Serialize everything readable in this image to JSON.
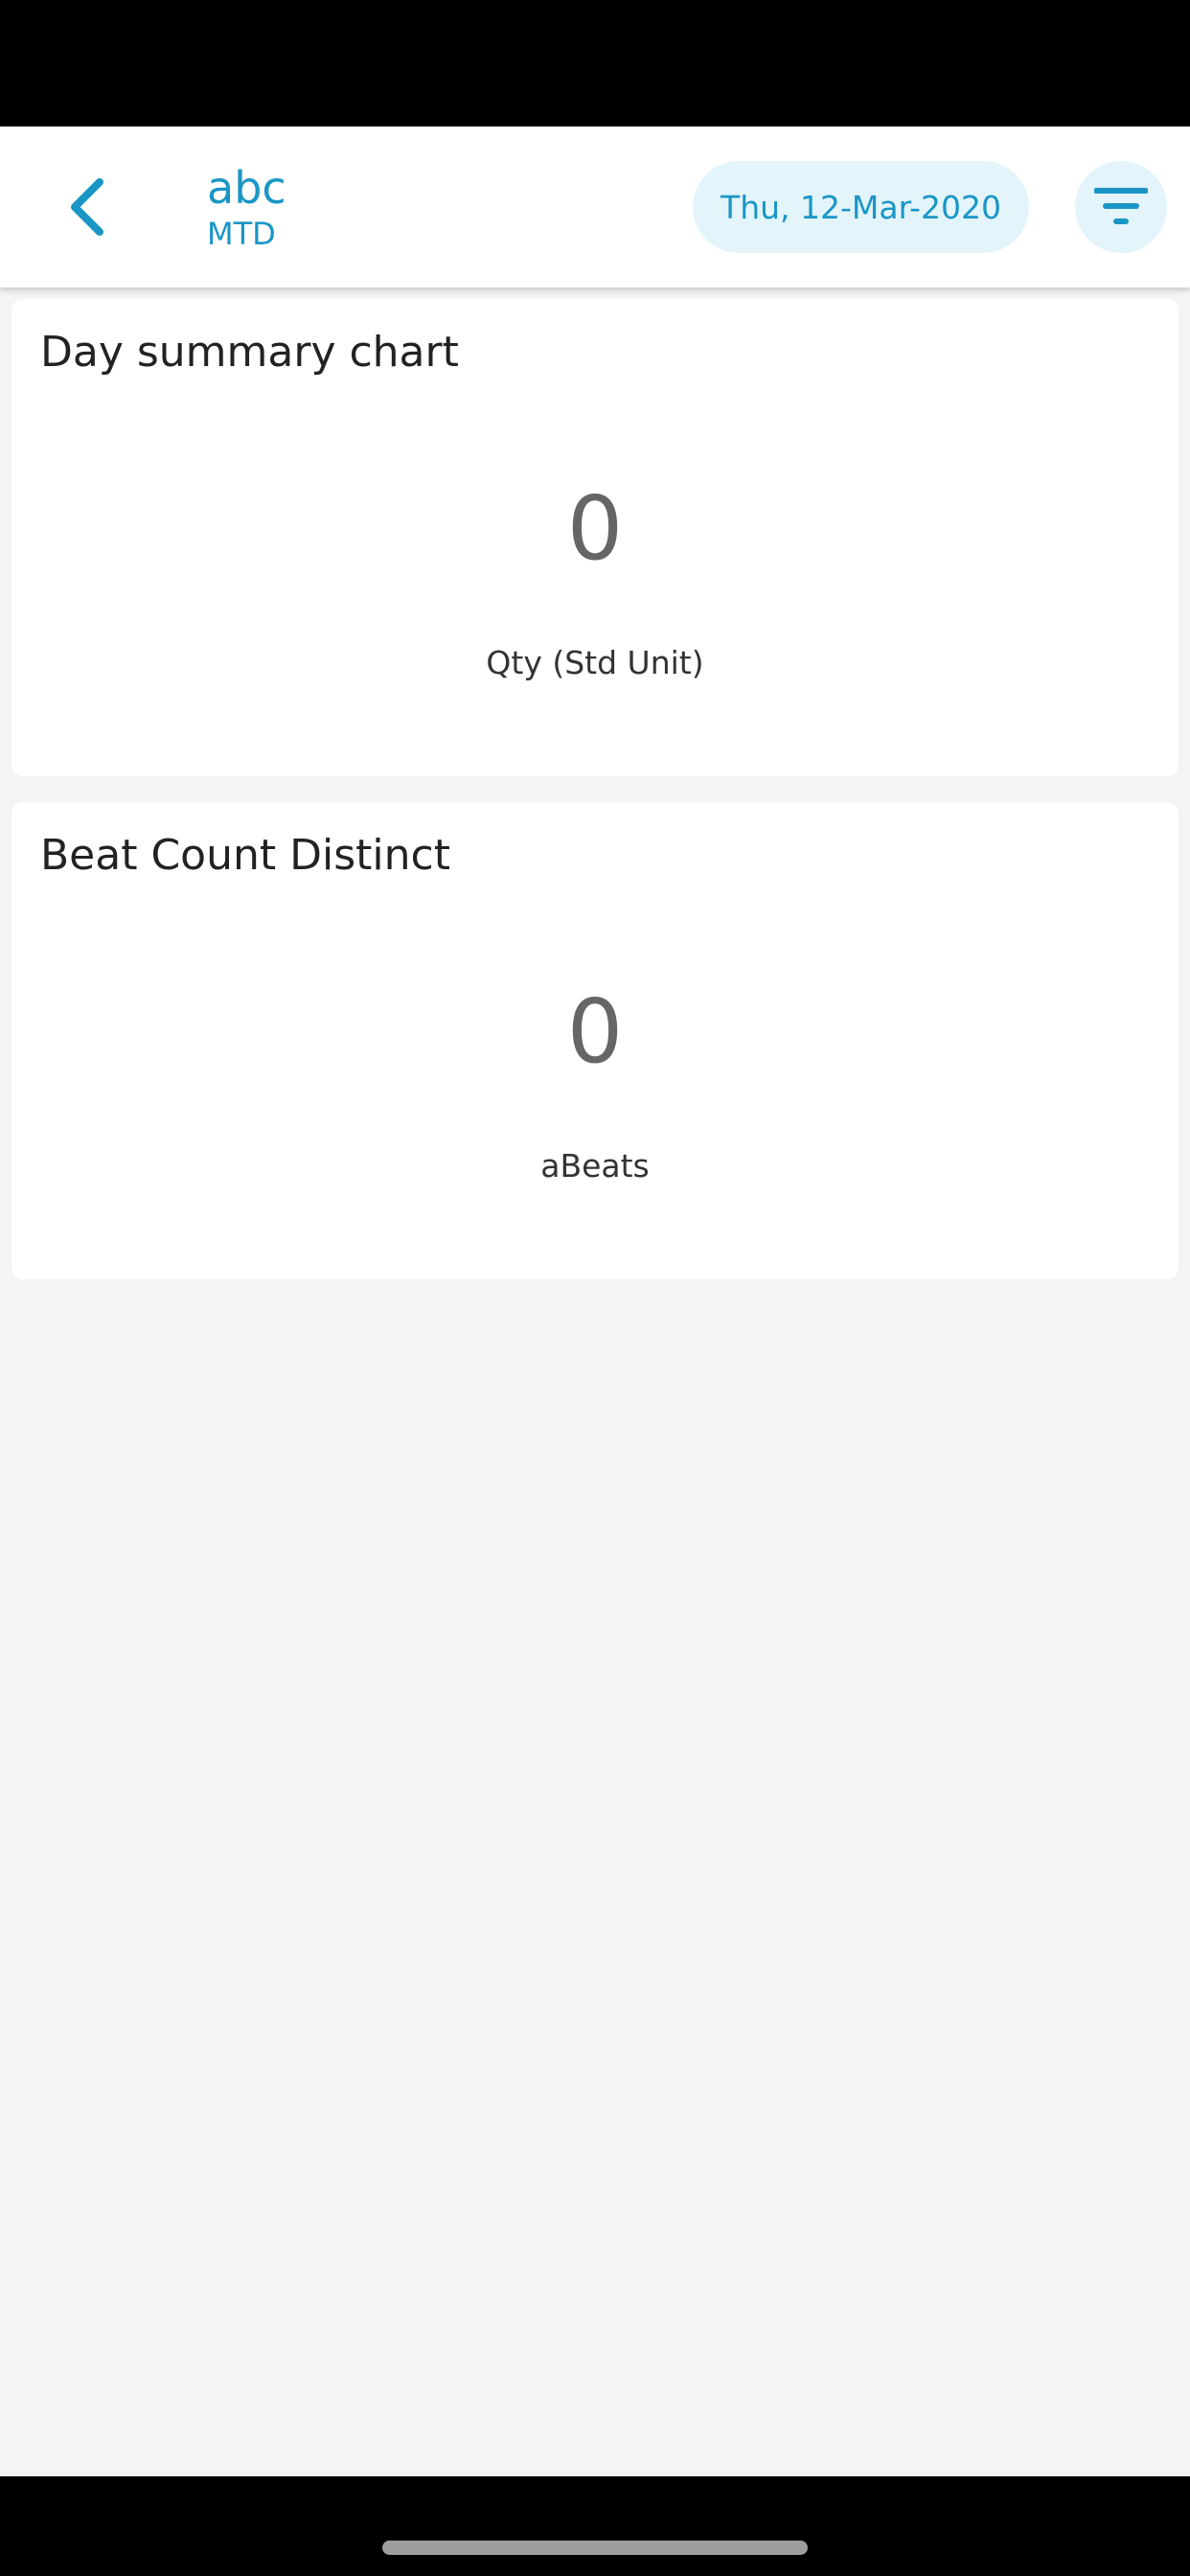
{
  "header": {
    "title": "abc",
    "subtitle": "MTD",
    "date": "Thu, 12-Mar-2020",
    "back_icon": "chevron-left-icon",
    "filter_icon": "filter-icon"
  },
  "cards": [
    {
      "title": "Day summary chart",
      "value": "0",
      "label": "Qty (Std Unit)"
    },
    {
      "title": "Beat Count Distinct",
      "value": "0",
      "label": "aBeats"
    }
  ],
  "colors": {
    "accent": "#1a96c6",
    "pill_background": "#e3f4fb",
    "page_background": "#f4f4f4",
    "card_background": "#ffffff"
  }
}
